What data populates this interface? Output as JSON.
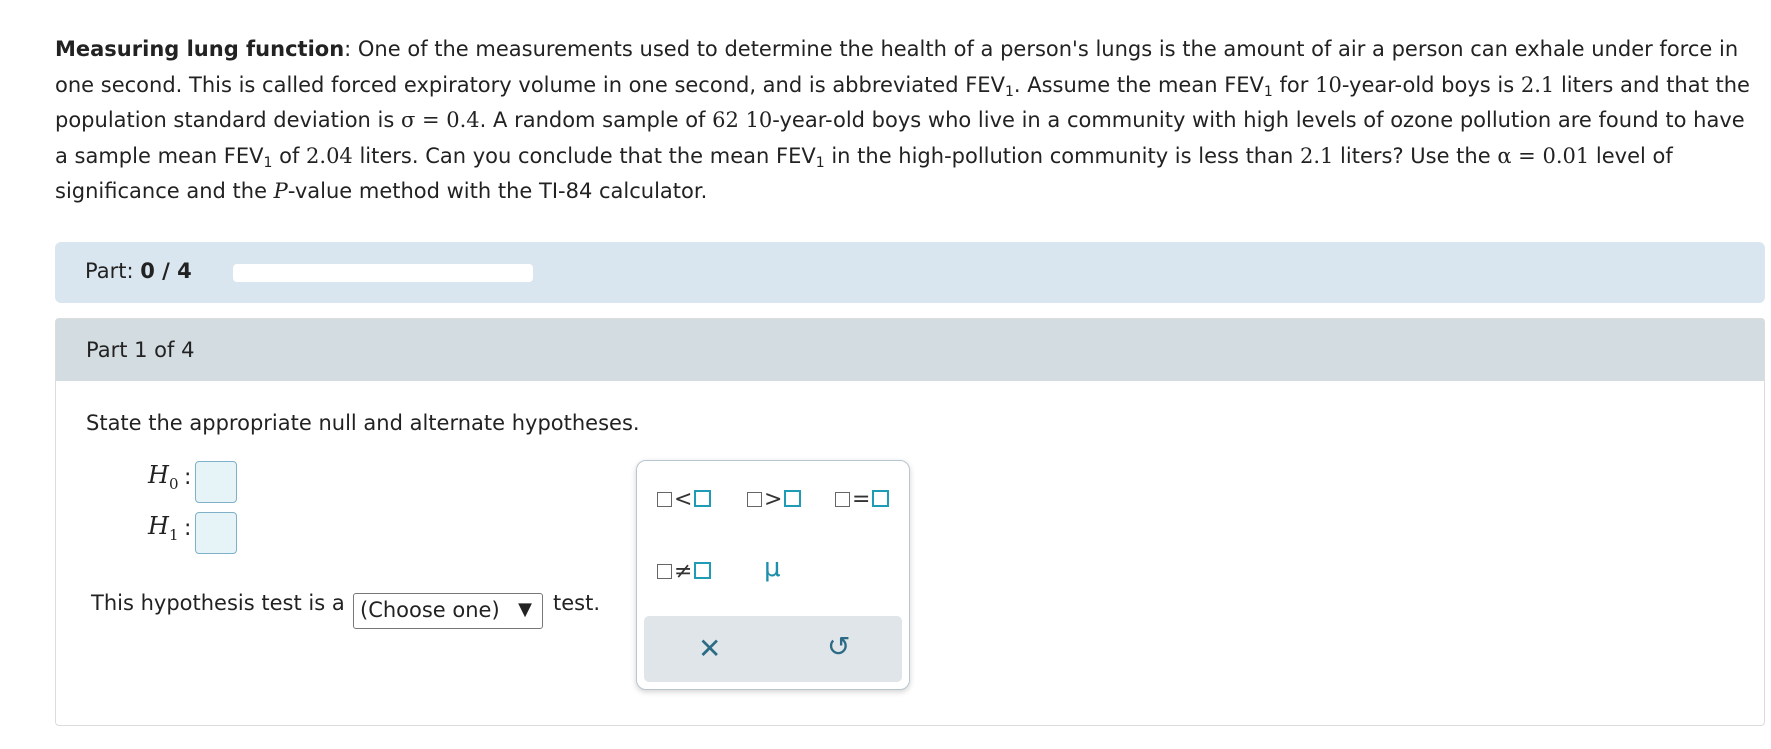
{
  "problem": {
    "title": "Measuring lung function",
    "t1": ": One of the measurements used to determine the health of a person's lungs is the amount of air a person can exhale under force in one second. This is called forced expiratory volume in one second, and is abbreviated FEV",
    "sub": "1",
    "t2": ". Assume the mean FEV",
    "t3": " for ",
    "n10a": "10",
    "t4": "-year-old boys is ",
    "n21a": "2.1",
    "t5": " liters and that the population standard deviation is ",
    "sigma": "σ = 0.4",
    "t6": ". A random sample of ",
    "n62": "62",
    "n10b": "10",
    "t7": "-year-old boys who live in a community with high levels of ozone pollution are found to have a sample mean FEV",
    "t8": " of ",
    "n204": "2.04",
    "t9": " liters. Can you conclude that the mean FEV",
    "t10": " in the high-pollution community is less than ",
    "n21b": "2.1",
    "t11": " liters? Use the ",
    "alpha": "α = 0.01",
    "t12": " level of significance and the ",
    "P": "P",
    "t13": "-value method with the TI-84 calculator."
  },
  "progress": {
    "label": "Part:",
    "value": "0 / 4",
    "fraction": 0
  },
  "part": {
    "title": "Part 1 of 4",
    "instruction": "State the appropriate null and alternate hypotheses.",
    "h0_letter": "H",
    "h0_sub": "0",
    "h1_letter": "H",
    "h1_sub": "1",
    "colon": ":",
    "test_prefix": "This hypothesis test is a",
    "select_value": "(Choose one)",
    "select_arrow": "▼",
    "test_suffix": "test."
  },
  "palette": {
    "less": "<",
    "greater": ">",
    "equal": "=",
    "not_equal": "≠",
    "mu": "μ",
    "clear": "✕",
    "undo": "↺"
  },
  "colors": {
    "progress_bg": "#dae6ef",
    "header_bg": "#d3dce0",
    "accent": "#1e9bb5"
  }
}
